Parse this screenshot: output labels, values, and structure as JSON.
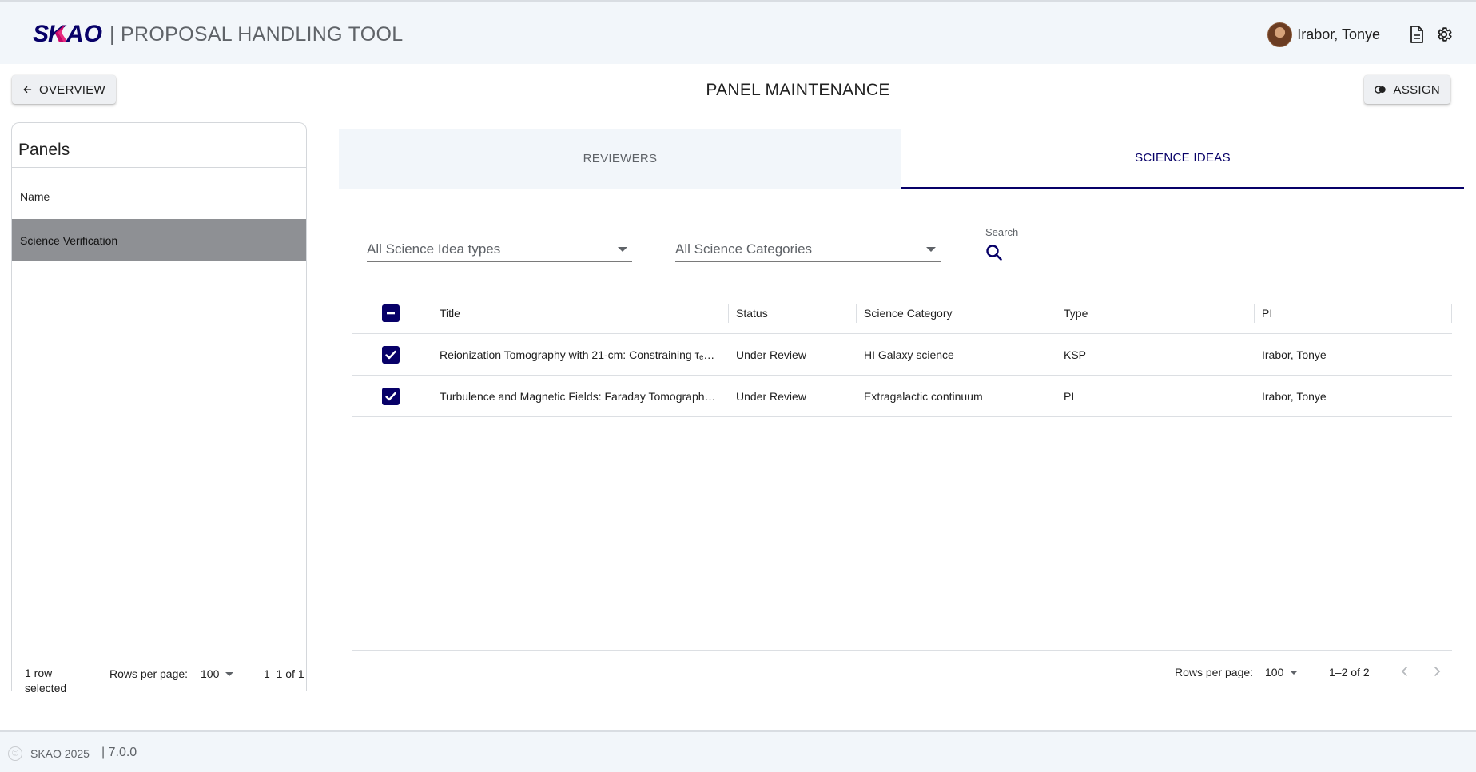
{
  "header": {
    "logo_text": "SKAO",
    "app_title": "| PROPOSAL HANDLING TOOL",
    "user_name": "Irabor, Tonye",
    "icons": [
      "avatar",
      "document-icon",
      "gear-icon"
    ]
  },
  "actions": {
    "overview_label": "OVERVIEW",
    "assign_label": "ASSIGN",
    "page_title": "PANEL MAINTENANCE"
  },
  "panels": {
    "title": "Panels",
    "column_header": "Name",
    "rows": [
      "Science Verification"
    ],
    "footer": {
      "selected": "1 row selected",
      "rows_per_page_label": "Rows per page:",
      "rows_per_page_value": "100",
      "range": "1–1 of 1"
    }
  },
  "tabs": {
    "reviewers": "REVIEWERS",
    "science_ideas": "SCIENCE IDEAS",
    "active": "science_ideas"
  },
  "filters": {
    "types_value": "All Science Idea types",
    "categories_value": "All Science Categories",
    "search_label": "Search",
    "search_value": ""
  },
  "table": {
    "columns": [
      "Title",
      "Status",
      "Science Category",
      "Type",
      "PI"
    ],
    "rows": [
      {
        "title": "Reionization Tomography with 21-cm: Constraining τₑ…",
        "status": "Under Review",
        "category": "HI Galaxy science",
        "type": "KSP",
        "pi": "Irabor, Tonye",
        "checked": true
      },
      {
        "title": "Turbulence and Magnetic Fields: Faraday Tomograph…",
        "status": "Under Review",
        "category": "Extragalactic continuum",
        "type": "PI",
        "pi": "Irabor, Tonye",
        "checked": true
      }
    ],
    "footer": {
      "rows_per_page_label": "Rows per page:",
      "rows_per_page_value": "100",
      "range": "1–2 of 2"
    }
  },
  "footer": {
    "copyright": "SKAO 2025",
    "version": "|  7.0.0"
  },
  "colors": {
    "brand_navy": "#070068",
    "brand_pink": "#e50869",
    "header_bg": "#f2f6fa",
    "selected_row": "#8e9094"
  }
}
